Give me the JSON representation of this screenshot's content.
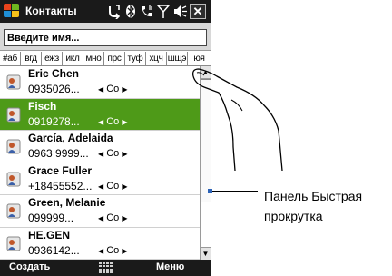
{
  "titlebar": {
    "app_title": "Контакты",
    "icons": [
      "sync-icon",
      "bluetooth-icon",
      "phone-signal-icon",
      "signal-strength-icon",
      "volume-icon"
    ],
    "close_label": "✕"
  },
  "search": {
    "placeholder": "Введите имя..."
  },
  "alphabet_tabs": [
    "#аб",
    "вгд",
    "ежз",
    "икл",
    "мно",
    "прс",
    "туф",
    "хцч",
    "шщэ",
    "юя"
  ],
  "contacts": [
    {
      "name": "Eric Chen",
      "phone": "0935026...",
      "type": "Со",
      "selected": false
    },
    {
      "name": "Fisch",
      "phone": "0919278...",
      "type": "Со",
      "selected": true
    },
    {
      "name": "García, Adelaida",
      "phone": "0963 9999...",
      "type": "Со",
      "selected": false
    },
    {
      "name": "Grace Fuller",
      "phone": "+18455552...",
      "type": "Со",
      "selected": false
    },
    {
      "name": "Green, Melanie",
      "phone": "099999...",
      "type": "Со",
      "selected": false
    },
    {
      "name": "HE.GEN",
      "phone": "0936142...",
      "type": "Со",
      "selected": false
    }
  ],
  "softkeys": {
    "left": "Создать",
    "right": "Меню"
  },
  "callout": {
    "label": "Панель Быстрая прокрутка"
  },
  "colors": {
    "selected_row": "#4e9a18",
    "bars": "#1a1a1a",
    "callout_marker": "#2c63b8"
  }
}
